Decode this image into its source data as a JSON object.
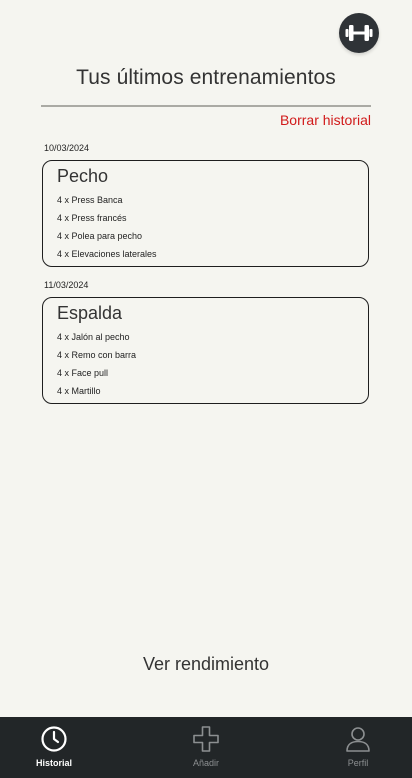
{
  "header": {
    "title": "Tus últimos entrenamientos",
    "clear_history": "Borrar historial",
    "logo_icon": "dumbbell-icon"
  },
  "workouts": [
    {
      "date": "10/03/2024",
      "name": "Pecho",
      "exercises": [
        "4 x Press Banca",
        "4 x Press francés",
        "4 x Polea para pecho",
        "4 x Elevaciones laterales"
      ]
    },
    {
      "date": "11/03/2024",
      "name": "Espalda",
      "exercises": [
        "4 x Jalón al pecho",
        "4 x Remo con barra",
        "4 x Face pull",
        "4 x Martillo"
      ]
    }
  ],
  "performance_link": "Ver rendimiento",
  "bottom_nav": {
    "items": [
      {
        "label": "Historial",
        "icon": "clock-icon",
        "active": true
      },
      {
        "label": "Añadir",
        "icon": "plus-icon",
        "active": false
      },
      {
        "label": "Perfil",
        "icon": "user-icon",
        "active": false
      }
    ]
  },
  "colors": {
    "background": "#f5f5f0",
    "accent_red": "#d11a1a",
    "nav_background": "#222628"
  }
}
